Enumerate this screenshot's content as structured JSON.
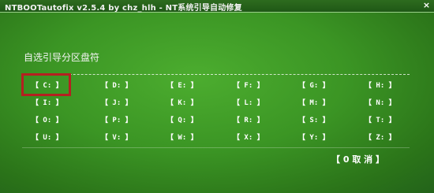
{
  "window": {
    "title": "NTBOOTautofix v2.5.4 by chz_hlh - NT系统引导自动修复",
    "close_glyph": "×"
  },
  "main": {
    "heading": "自选引导分区盘符",
    "selected_drive": "C:",
    "drives": [
      [
        "【 C: 】",
        "【 D: 】",
        "【 E: 】",
        "【 F: 】",
        "【 G: 】",
        "【 H: 】"
      ],
      [
        "【 I: 】",
        "【 J: 】",
        "【 K: 】",
        "【 L: 】",
        "【 M: 】",
        "【 N: 】"
      ],
      [
        "【 O: 】",
        "【 P: 】",
        "【 Q: 】",
        "【 R: 】",
        "【 S: 】",
        "【 T: 】"
      ],
      [
        "【 U: 】",
        "【 V: 】",
        "【 W: 】",
        "【 X: 】",
        "【 Y: 】",
        "【 Z: 】"
      ]
    ],
    "cancel_label": "【 0 取  消 】"
  },
  "colors": {
    "background": "#3b9524",
    "text": "#ffffff",
    "selection_border": "#b52020"
  }
}
